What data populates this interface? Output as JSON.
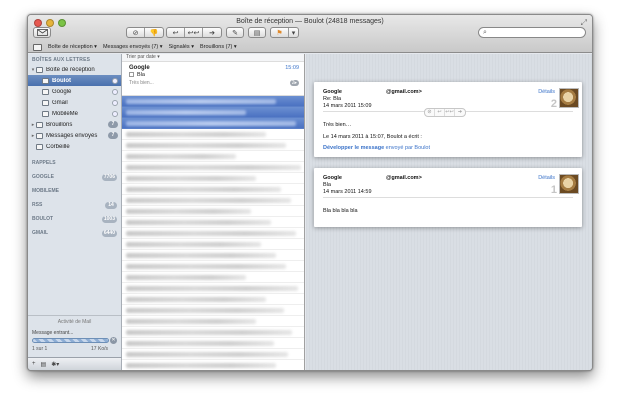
{
  "window": {
    "title": "Boîte de réception — Boulot (24818 messages)"
  },
  "toolbar": {
    "get_mail_icon": "envelope-icon",
    "buttons": [
      "⊘",
      "👎",
      "↩",
      "↩↩",
      "➔",
      "✎",
      "▤"
    ],
    "search_placeholder": ""
  },
  "favorites": [
    "Boîte de réception ▾",
    "Messages envoyés (7) ▾",
    "Signalés ▾",
    "Brouillons (7) ▾"
  ],
  "sidebar": {
    "header": "BOÎTES AUX LETTRES",
    "items": [
      {
        "label": "Boîte de réception",
        "indent": 0,
        "disclosure": "▾"
      },
      {
        "label": "Boulot",
        "indent": 1,
        "selected": true
      },
      {
        "label": "Google",
        "indent": 1
      },
      {
        "label": "Gmail",
        "indent": 1
      },
      {
        "label": "MobileMe",
        "indent": 1
      },
      {
        "label": "Brouillons",
        "indent": 0,
        "disclosure": "▸",
        "count": "7"
      },
      {
        "label": "Messages envoyés",
        "indent": 0,
        "disclosure": "▸",
        "count": "7"
      },
      {
        "label": "Corbeille",
        "indent": 0
      }
    ],
    "groups": [
      {
        "label": "RAPPELS",
        "count": ""
      },
      {
        "label": "GOOGLE",
        "count": "7706"
      },
      {
        "label": "MOBILEME",
        "count": ""
      },
      {
        "label": "RSS",
        "count": "14"
      },
      {
        "label": "BOULOT",
        "count": "1003"
      },
      {
        "label": "GMAIL",
        "count": "6440"
      }
    ],
    "activity": {
      "title": "Activité de Mail",
      "message": "Message entrant...",
      "progress": "1 sur 1",
      "speed": "17 Ko/s"
    },
    "footer": {
      "add": "+",
      "mailbox": "▤",
      "gear": "✱▾"
    }
  },
  "message_list": {
    "sort_label": "Trier par date ▾",
    "selected": {
      "from": "Google",
      "subject": "Bla",
      "time": "15:09",
      "preview": "Très bien...",
      "thread_count": "2▸"
    }
  },
  "viewer": {
    "messages": [
      {
        "from": "Google",
        "address": "@gmail.com>",
        "subject": "Re: Bla",
        "date": "14 mars 2011 15:09",
        "details": "Détails",
        "index": "2",
        "body_line1": "Très bien…",
        "body_line2": "Le 14 mars 2011 à 15:07, Boulot a écrit :",
        "expand_link": "Développer le message",
        "expand_suffix": " envoyé par Boulot"
      },
      {
        "from": "Google",
        "address": "@gmail.com>",
        "subject": "Bla",
        "date": "14 mars 2011 14:59",
        "details": "Détails",
        "index": "1",
        "body_line1": "Bla bla bla bla"
      }
    ]
  },
  "colors": {
    "selection": "#4b72c2",
    "link": "#3b73c9",
    "sidebar_bg": "#dde3ea"
  }
}
